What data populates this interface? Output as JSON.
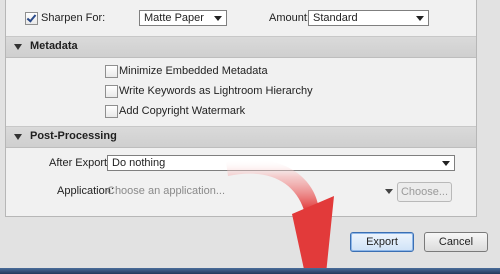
{
  "sharpen": {
    "checkbox_label": "Sharpen For:",
    "checked": true,
    "sharpen_for_value": "Matte Paper",
    "amount_label": "Amount:",
    "amount_value": "Standard"
  },
  "metadata": {
    "title": "Metadata",
    "options": [
      {
        "label": "Minimize Embedded Metadata",
        "checked": false
      },
      {
        "label": "Write Keywords as Lightroom Hierarchy",
        "checked": false
      },
      {
        "label": "Add Copyright Watermark",
        "checked": false
      }
    ]
  },
  "post_processing": {
    "title": "Post-Processing",
    "after_export_label": "After Export:",
    "after_export_value": "Do nothing",
    "application_label": "Application:",
    "application_placeholder": "Choose an application...",
    "choose_button": "Choose..."
  },
  "footer": {
    "export_button": "Export",
    "cancel_button": "Cancel"
  },
  "colors": {
    "arrow": "#e23a3a",
    "default_button_border": "#3b6fb3"
  }
}
